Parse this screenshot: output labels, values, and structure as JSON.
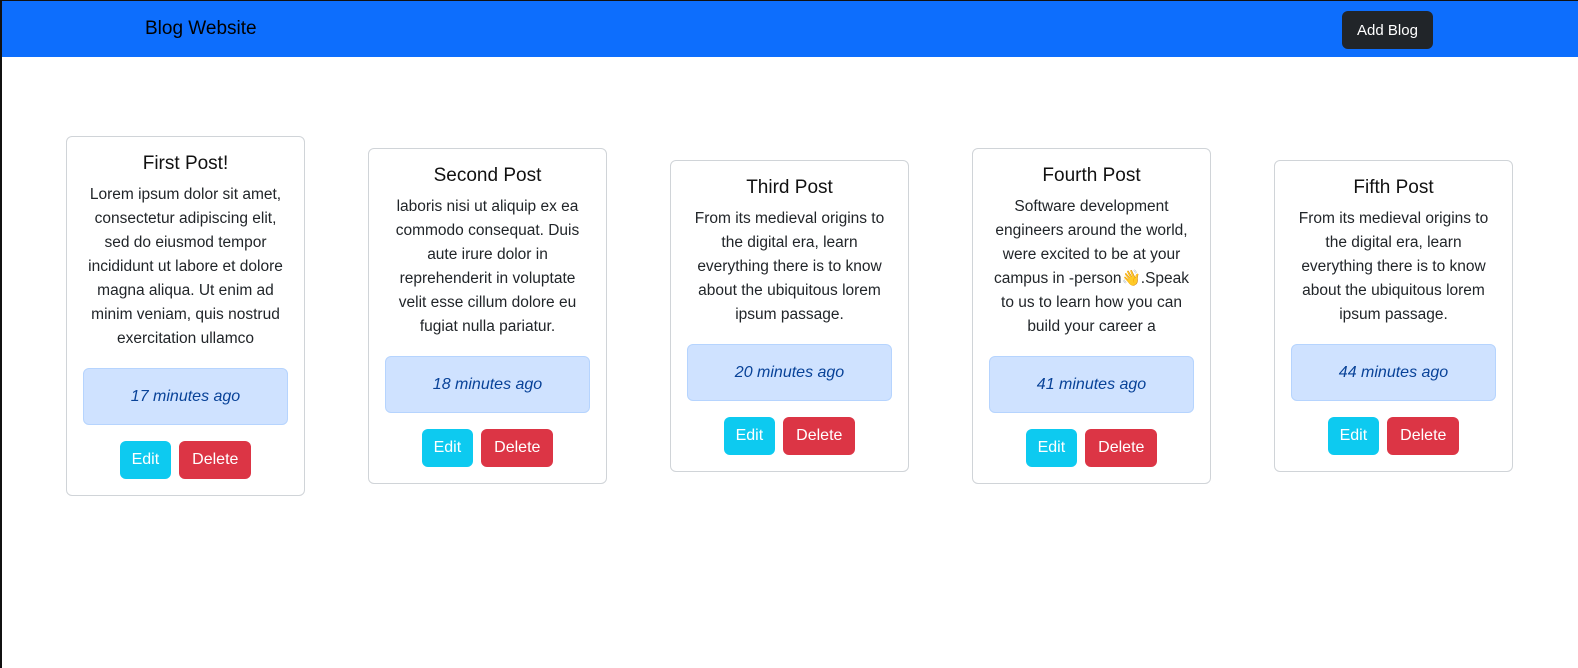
{
  "navbar": {
    "brand": "Blog Website",
    "add_blog_label": "Add Blog"
  },
  "posts": [
    {
      "title": "First Post!",
      "body": "Lorem ipsum dolor sit amet, consectetur adipiscing elit, sed do eiusmod tempor incididunt ut labore et dolore magna aliqua. Ut enim ad minim veniam, quis nostrud exercitation ullamco",
      "time": "17 minutes ago",
      "edit_label": "Edit",
      "delete_label": "Delete"
    },
    {
      "title": "Second Post",
      "body": "laboris nisi ut aliquip ex ea commodo consequat. Duis aute irure dolor in reprehenderit in voluptate velit esse cillum dolore eu fugiat nulla pariatur.",
      "time": "18 minutes ago",
      "edit_label": "Edit",
      "delete_label": "Delete"
    },
    {
      "title": "Third Post",
      "body": "From its medieval origins to the digital era, learn everything there is to know about the ubiquitous lorem ipsum passage.",
      "time": "20 minutes ago",
      "edit_label": "Edit",
      "delete_label": "Delete"
    },
    {
      "title": "Fourth Post",
      "body": "Software development engineers around the world, were excited to be at your campus in -person👋.Speak to us to learn how you can build your career a",
      "time": "41 minutes ago",
      "edit_label": "Edit",
      "delete_label": "Delete"
    },
    {
      "title": "Fifth Post",
      "body": "From its medieval origins to the digital era, learn everything there is to know about the ubiquitous lorem ipsum passage.",
      "time": "44 minutes ago",
      "edit_label": "Edit",
      "delete_label": "Delete"
    }
  ]
}
